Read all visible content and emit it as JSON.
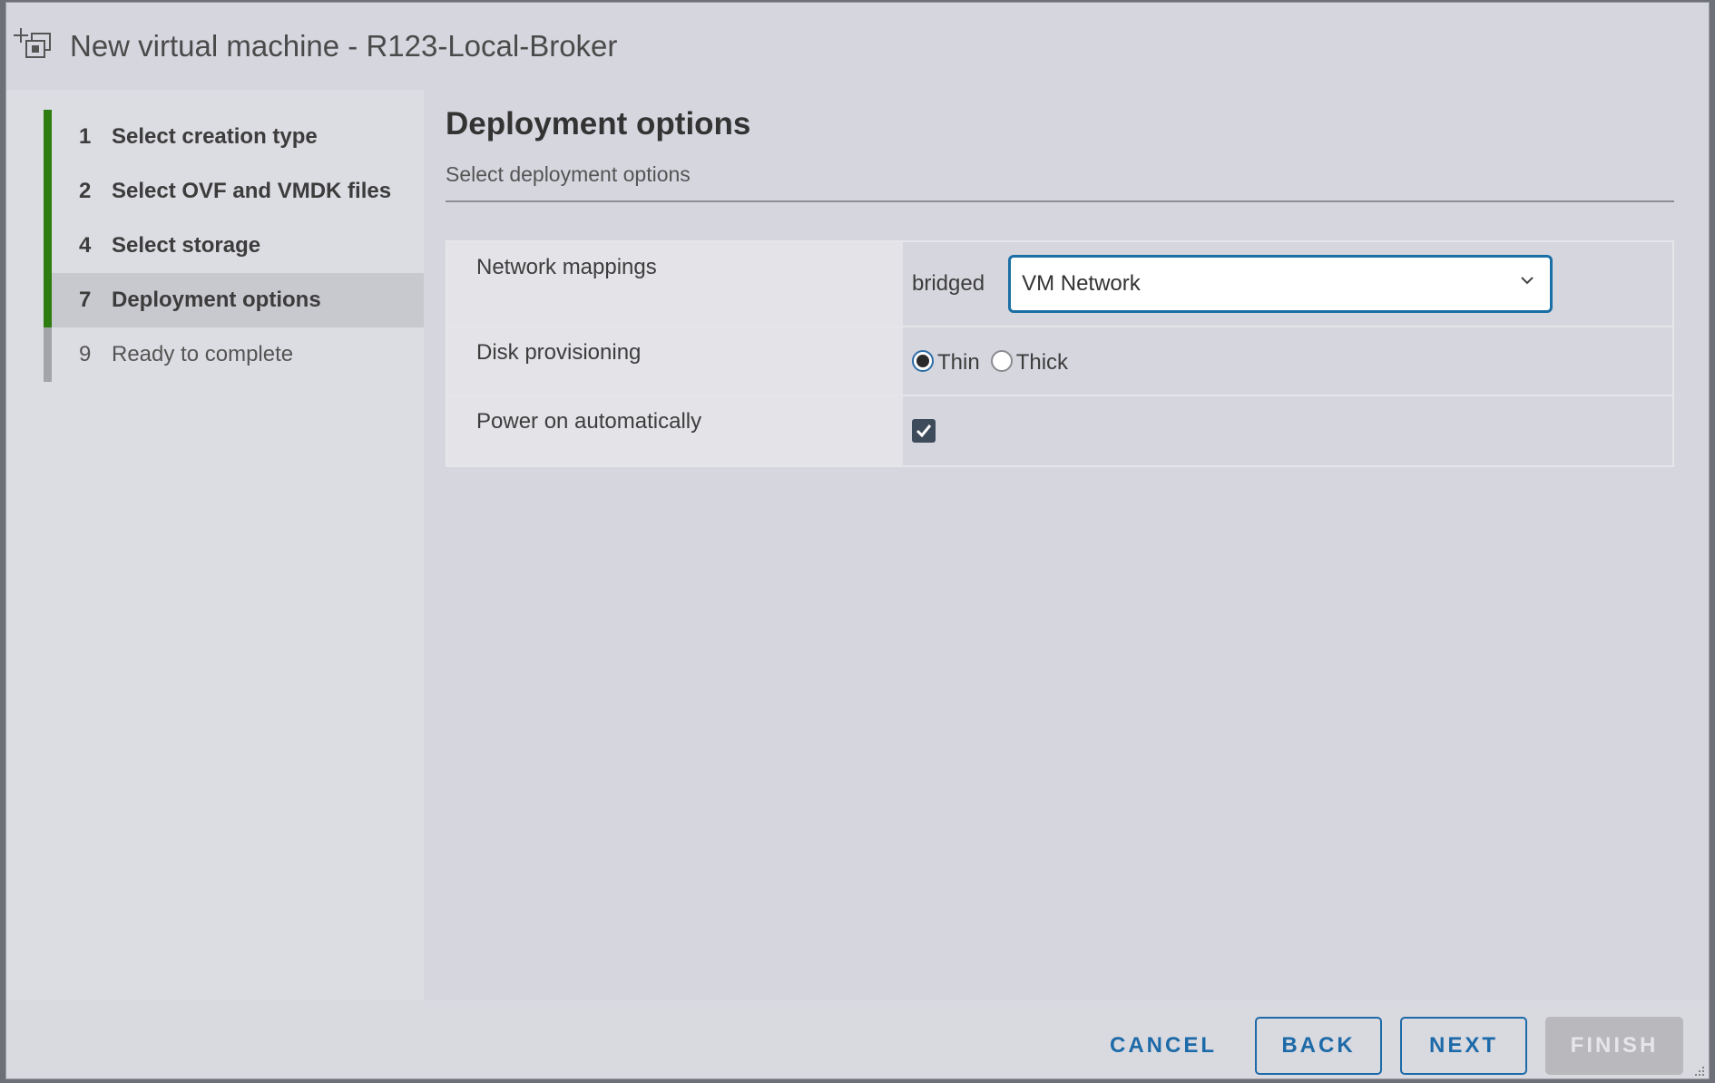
{
  "window": {
    "title": "New virtual machine - R123-Local-Broker"
  },
  "sidebar": {
    "steps": [
      {
        "num": "1",
        "label": "Select creation type",
        "state": "done"
      },
      {
        "num": "2",
        "label": "Select OVF and VMDK files",
        "state": "done"
      },
      {
        "num": "4",
        "label": "Select storage",
        "state": "done"
      },
      {
        "num": "7",
        "label": "Deployment options",
        "state": "active"
      },
      {
        "num": "9",
        "label": "Ready to complete",
        "state": "pending"
      }
    ]
  },
  "main": {
    "title": "Deployment options",
    "subtitle": "Select deployment options",
    "options": {
      "network": {
        "label": "Network mappings",
        "source": "bridged",
        "selected": "VM Network"
      },
      "disk": {
        "label": "Disk provisioning",
        "thin_label": "Thin",
        "thick_label": "Thick",
        "selected": "Thin"
      },
      "power": {
        "label": "Power on automatically",
        "checked": true
      }
    }
  },
  "footer": {
    "cancel": "CANCEL",
    "back": "BACK",
    "next": "NEXT",
    "finish": "FINISH"
  },
  "colors": {
    "accent": "#1d6aa8",
    "step_done": "#2e7d10",
    "step_pending": "#a3a3aa",
    "dialog_bg": "#d6d6df"
  }
}
